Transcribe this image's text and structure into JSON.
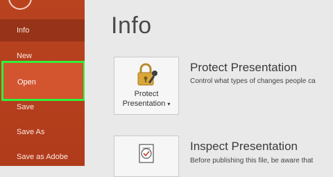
{
  "sidebar": {
    "items": [
      {
        "label": "Info"
      },
      {
        "label": "New"
      },
      {
        "label": "Open"
      },
      {
        "label": "Save"
      },
      {
        "label": "Save As"
      },
      {
        "label": "Save as Adobe"
      }
    ],
    "back_icon": "back-arrow-icon"
  },
  "main": {
    "title": "Info",
    "protect": {
      "button_line1": "Protect",
      "button_line2": "Presentation",
      "dropdown_glyph": "▾",
      "heading": "Protect Presentation",
      "description": "Control what types of changes people ca",
      "icon": "lock-key-icon"
    },
    "inspect": {
      "heading": "Inspect Presentation",
      "description": "Before publishing this file, be aware that",
      "icon": "document-check-icon"
    }
  },
  "colors": {
    "sidebar_bg": "#b9431f",
    "selected_item_bg": "#973318",
    "open_item_bg": "#d2552f",
    "highlight_border": "#2ff23a",
    "content_bg": "#e9e9e9"
  }
}
